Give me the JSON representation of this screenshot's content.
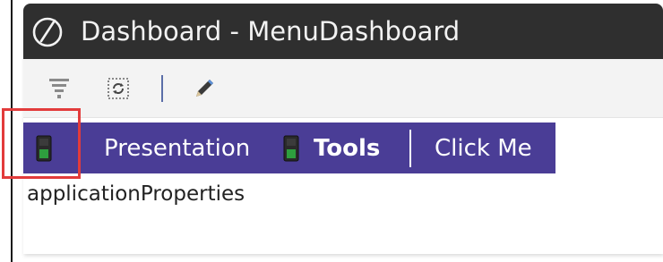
{
  "window": {
    "title": "Dashboard - MenuDashboard"
  },
  "toolbar": {
    "buttons": [
      {
        "icon": "filter-icon"
      },
      {
        "icon": "refresh-icon"
      },
      {
        "icon": "pencil-icon"
      }
    ]
  },
  "menubar": {
    "background": "#4a3d96",
    "items": [
      {
        "label": "",
        "icon": "device-icon"
      },
      {
        "label": "Presentation"
      },
      {
        "label": "Tools",
        "icon": "device-icon",
        "bold": true
      },
      {
        "label": "Click Me"
      }
    ]
  },
  "content": {
    "text": "applicationProperties"
  },
  "colors": {
    "titlebar": "#2f2f2f",
    "highlight": "#e23b3b",
    "device_icon_green": "#2e9e3e"
  }
}
